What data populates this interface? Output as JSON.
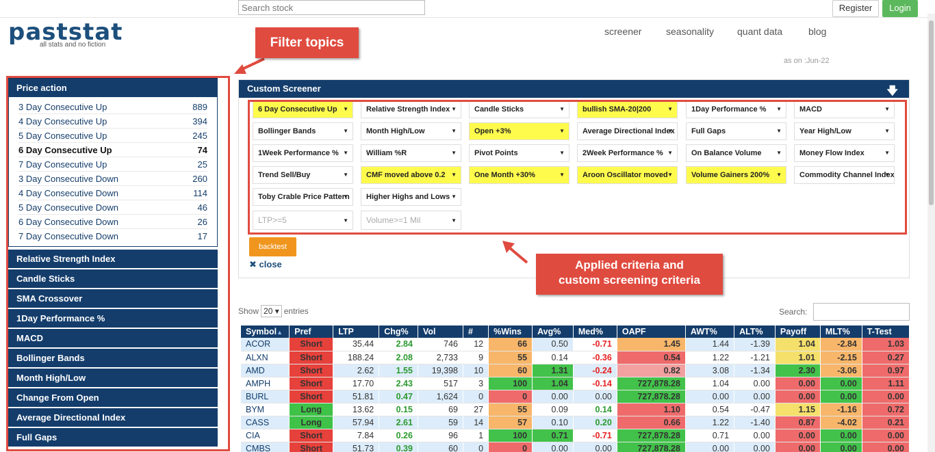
{
  "header": {
    "search_placeholder": "Search stock",
    "register": "Register",
    "login": "Login",
    "logo_main": "paststat",
    "logo_sub": "all stats and no fiction",
    "nav": [
      "screener",
      "seasonality",
      "quant data",
      "blog"
    ],
    "as_on": "as on :Jun-22"
  },
  "annotations": {
    "filter_topics": "Filter topics",
    "applied_line1": "Applied criteria and",
    "applied_line2": "custom screening criteria"
  },
  "sidebar": {
    "section": "Price action",
    "items": [
      {
        "label": "3 Day Consecutive Up",
        "count": "889"
      },
      {
        "label": "4 Day Consecutive Up",
        "count": "394"
      },
      {
        "label": "5 Day Consecutive Up",
        "count": "245"
      },
      {
        "label": "6 Day Consecutive Up",
        "count": "74"
      },
      {
        "label": "7 Day Consecutive Up",
        "count": "25"
      },
      {
        "label": "3 Day Consecutive Down",
        "count": "260"
      },
      {
        "label": "4 Day Consecutive Down",
        "count": "114"
      },
      {
        "label": "5 Day Consecutive Down",
        "count": "46"
      },
      {
        "label": "6 Day Consecutive Down",
        "count": "26"
      },
      {
        "label": "7 Day Consecutive Down",
        "count": "17"
      }
    ],
    "categories": [
      "Relative Strength Index",
      "Candle Sticks",
      "SMA Crossover",
      "1Day Performance %",
      "MACD",
      "Bollinger Bands",
      "Month High/Low",
      "Change From Open",
      "Average Directional Index",
      "Full Gaps"
    ]
  },
  "screener": {
    "title": "Custom Screener",
    "criteria": [
      [
        "6 Day Consecutive Up",
        "Relative Strength Index",
        "Candle Sticks",
        "bullish SMA-20|200",
        "1Day Performance %",
        "MACD"
      ],
      [
        "Bollinger Bands",
        "Month High/Low",
        "Open +3%",
        "Average Directional Index",
        "Full Gaps",
        "Year High/Low"
      ],
      [
        "1Week Performance %",
        "William %R",
        "Pivot Points",
        "2Week Performance %",
        "On Balance Volume",
        "Money Flow Index"
      ],
      [
        "Trend Sell/Buy",
        "CMF moved above 0.2",
        "One Month +30%",
        "Aroon Oscillator moved",
        "Volume Gainers 200%",
        "Commodity Channel Index"
      ],
      [
        "Toby Crable Price Pattern",
        "Higher Highs and Lows"
      ],
      [
        "LTP>=5",
        "Volume>=1 Mil"
      ]
    ],
    "backtest": "backtest",
    "close": "close"
  },
  "table_controls": {
    "show": "Show",
    "entries_value": "20",
    "entries": "entries",
    "search": "Search:"
  },
  "table": {
    "headers": [
      "Symbol",
      "Pref",
      "LTP",
      "Chg%",
      "Vol",
      "#",
      "%Wins",
      "Avg%",
      "Med%",
      "OAPF",
      "AWT%",
      "ALT%",
      "Payoff",
      "MLT%",
      "T-Test"
    ],
    "rows": [
      [
        "ACOR",
        "Short",
        "35.44",
        "2.84",
        "746",
        "12",
        "66",
        "0.50",
        "-0.71",
        "1.45",
        "1.44",
        "-1.39",
        "1.04",
        "-2.84",
        "1.03"
      ],
      [
        "ALXN",
        "Short",
        "188.24",
        "2.08",
        "2,733",
        "9",
        "55",
        "0.14",
        "-0.36",
        "0.54",
        "1.22",
        "-1.21",
        "1.01",
        "-2.15",
        "0.27"
      ],
      [
        "AMD",
        "Short",
        "2.62",
        "1.55",
        "19,398",
        "10",
        "60",
        "1.31",
        "-0.24",
        "0.82",
        "3.08",
        "-1.34",
        "2.30",
        "-3.06",
        "0.97"
      ],
      [
        "AMPH",
        "Short",
        "17.70",
        "2.43",
        "517",
        "3",
        "100",
        "1.04",
        "-0.14",
        "727,878.28",
        "1.04",
        "0.00",
        "0.00",
        "0.00",
        "1.11"
      ],
      [
        "BURL",
        "Short",
        "51.81",
        "0.47",
        "1,624",
        "0",
        "0",
        "0.00",
        "0.00",
        "727,878.28",
        "0.00",
        "0.00",
        "0.00",
        "0.00",
        "0.00"
      ],
      [
        "BYM",
        "Long",
        "13.62",
        "0.15",
        "69",
        "27",
        "55",
        "0.09",
        "0.14",
        "1.10",
        "0.54",
        "-0.47",
        "1.15",
        "-1.16",
        "0.72"
      ],
      [
        "CASS",
        "Long",
        "57.94",
        "2.61",
        "59",
        "14",
        "57",
        "0.10",
        "0.20",
        "0.66",
        "1.22",
        "-1.40",
        "0.87",
        "-4.02",
        "0.21"
      ],
      [
        "CIA",
        "Short",
        "7.84",
        "0.26",
        "96",
        "1",
        "100",
        "0.71",
        "-0.71",
        "727,878.28",
        "0.71",
        "0.00",
        "0.00",
        "0.00",
        "0.00"
      ],
      [
        "CMBS",
        "Short",
        "51.73",
        "0.39",
        "60",
        "0",
        "0",
        "0.00",
        "0.00",
        "727,878.28",
        "0.00",
        "0.00",
        "0.00",
        "0.00",
        "0.00"
      ]
    ]
  }
}
